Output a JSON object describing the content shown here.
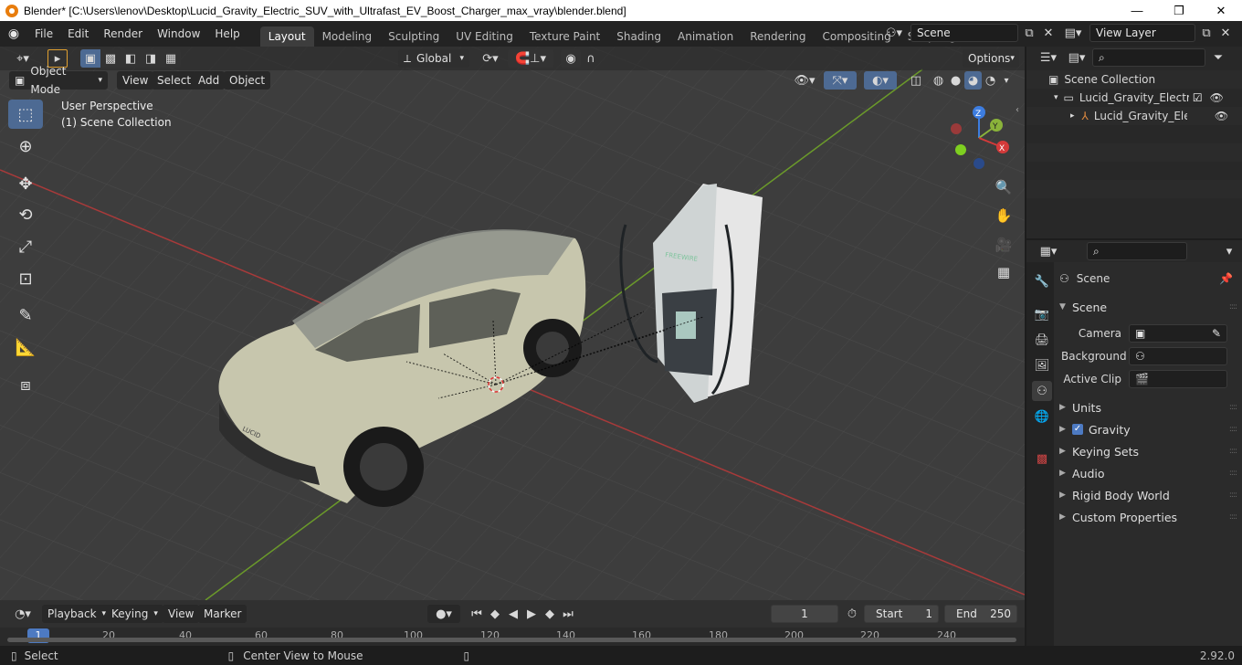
{
  "window": {
    "title": "Blender* [C:\\Users\\lenov\\Desktop\\Lucid_Gravity_Electric_SUV_with_Ultrafast_EV_Boost_Charger_max_vray\\blender.blend]",
    "minimize": "—",
    "maximize": "❐",
    "close": "✕"
  },
  "menu": [
    "File",
    "Edit",
    "Render",
    "Window",
    "Help"
  ],
  "workspaces": [
    "Layout",
    "Modeling",
    "Sculpting",
    "UV Editing",
    "Texture Paint",
    "Shading",
    "Animation",
    "Rendering",
    "Compositing",
    "Scripting"
  ],
  "add_workspace": "+",
  "scene_field": "Scene",
  "view_layer_field": "View Layer",
  "viewport": {
    "transform_orientation": "Global",
    "options_label": "Options",
    "mode": "Object Mode",
    "header_menus": [
      "View",
      "Select",
      "Add",
      "Object"
    ],
    "overlay_line1": "User Perspective",
    "overlay_line2": "(1) Scene Collection",
    "gizmo": {
      "z": "Z",
      "y": "Y",
      "x": "X"
    },
    "colors": {
      "background": "#3d3d3d",
      "grid": "#4a4a4a",
      "x_axis": "#b03a3a",
      "y_axis": "#6b9a2a",
      "active_tool": "#4d6a93"
    },
    "car_brand": "LUCID",
    "charger_brand": "FREEWIRE"
  },
  "outliner": {
    "root": "Scene Collection",
    "items": [
      "Lucid_Gravity_Electric_S",
      "Lucid_Gravity_Electr"
    ]
  },
  "properties": {
    "header": "Scene",
    "section": "Scene",
    "fields": [
      {
        "label": "Camera",
        "value": ""
      },
      {
        "label": "Background ...",
        "value": ""
      },
      {
        "label": "Active Clip",
        "value": ""
      }
    ],
    "panels": [
      "Units",
      "Gravity",
      "Keying Sets",
      "Audio",
      "Rigid Body World",
      "Custom Properties"
    ],
    "gravity_checked": true
  },
  "timeline": {
    "menus": [
      "Playback",
      "Keying",
      "View",
      "Marker"
    ],
    "current_frame": "1",
    "start_label": "Start",
    "start_value": "1",
    "end_label": "End",
    "end_value": "250",
    "ruler": [
      "1",
      "20",
      "40",
      "60",
      "80",
      "100",
      "120",
      "140",
      "160",
      "180",
      "200",
      "220",
      "240"
    ]
  },
  "status": {
    "select": "Select",
    "center": "Center View to Mouse",
    "version": "2.92.0"
  }
}
